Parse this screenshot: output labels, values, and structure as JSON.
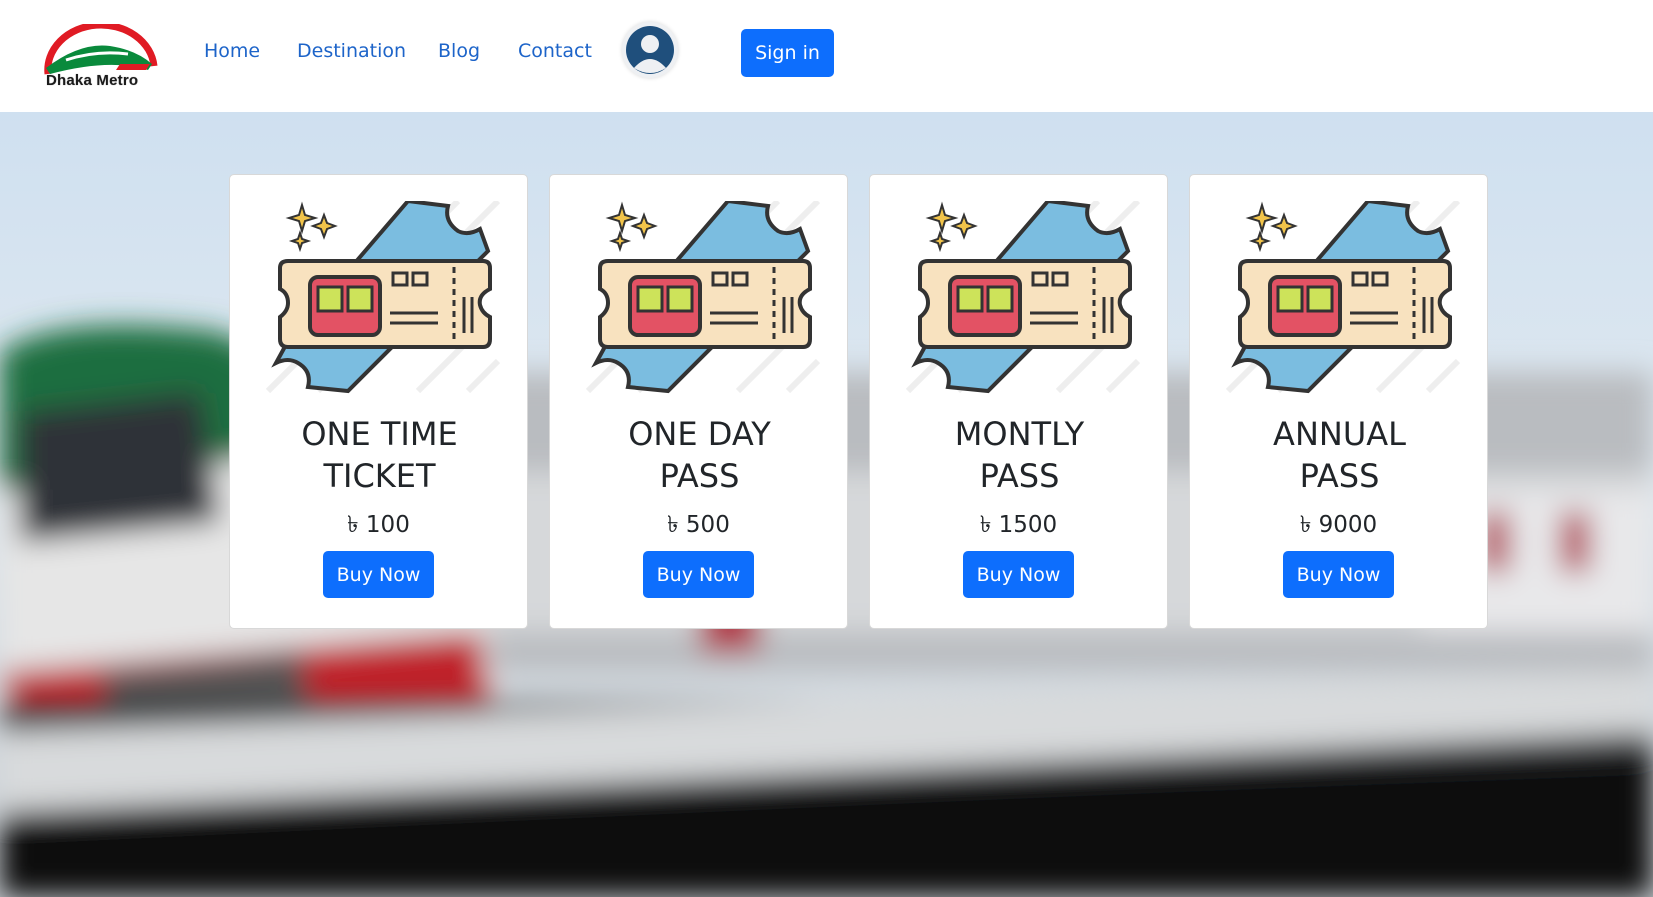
{
  "brand": {
    "logo_text": "Dhaka Metro"
  },
  "nav": {
    "links": [
      "Home",
      "Destination",
      "Blog",
      "Contact"
    ],
    "signin_label": "Sign in"
  },
  "cards": [
    {
      "title_line1": "ONE TIME",
      "title_line2": "TICKET",
      "price": "৳ 100",
      "button": "Buy Now"
    },
    {
      "title_line1": "ONE DAY",
      "title_line2": "PASS",
      "price": "৳ 500",
      "button": "Buy Now"
    },
    {
      "title_line1": "MONTLY",
      "title_line2": "PASS",
      "price": "৳ 1500",
      "button": "Buy Now"
    },
    {
      "title_line1": "ANNUAL",
      "title_line2": "PASS",
      "price": "৳ 9000",
      "button": "Buy Now"
    }
  ],
  "colors": {
    "primary": "#0d6efd",
    "nav_link": "#1d64c9",
    "text": "#212529"
  },
  "icons": [
    "metro-logo-icon",
    "user-avatar-icon",
    "train-ticket-icon"
  ]
}
